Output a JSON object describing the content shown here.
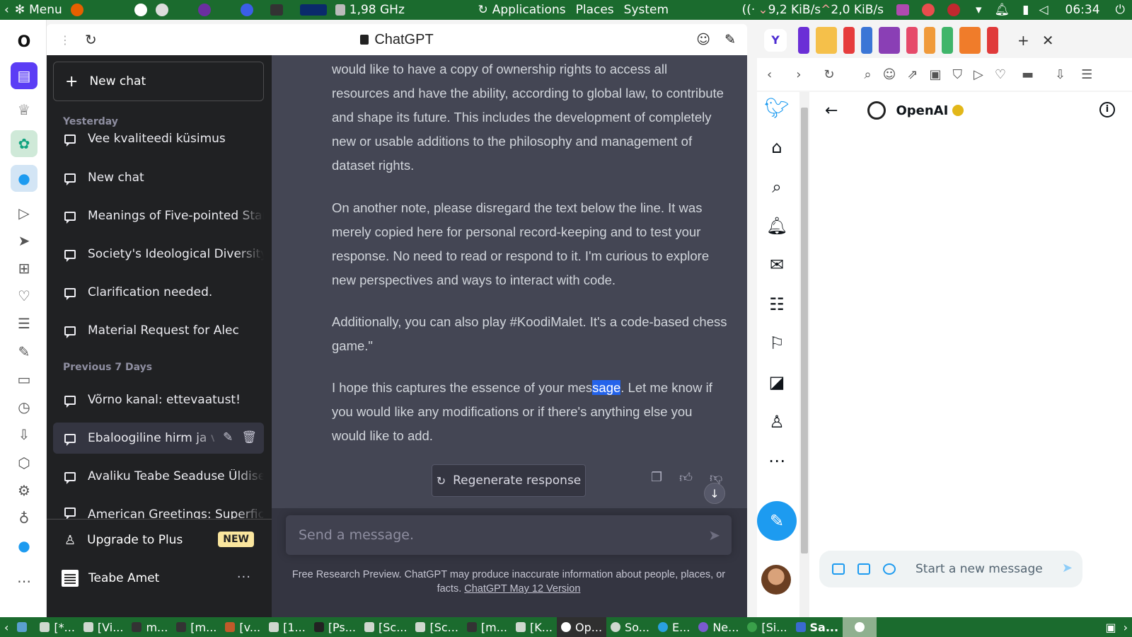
{
  "system_panel": {
    "menu_label": "Menu",
    "cpu_freq": "1,98 GHz",
    "menus": [
      "Applications",
      "Places",
      "System"
    ],
    "net_down": "9,2 KiB/s",
    "net_up": "2,0 KiB/s",
    "clock": "06:34"
  },
  "chatgpt": {
    "tab_title": "ChatGPT",
    "new_chat_label": "New chat",
    "sections": {
      "yesterday": "Yesterday",
      "previous_7_days": "Previous 7 Days"
    },
    "conversations": [
      {
        "label": "Vee kvaliteedi küsimus"
      },
      {
        "label": "New chat"
      },
      {
        "label": "Meanings of Five-pointed Star"
      },
      {
        "label": "Society's Ideological Diversity"
      },
      {
        "label": "Clarification needed."
      },
      {
        "label": "Material Request for Alec"
      },
      {
        "label": "Võrno kanal: ettevaatust!"
      },
      {
        "label": "Ebaloogiline hirm ja vabadus"
      },
      {
        "label": "Avaliku Teabe Seaduse Üldised"
      },
      {
        "label": "American Greetings: Superficial"
      }
    ],
    "upgrade_label": "Upgrade to Plus",
    "upgrade_badge": "NEW",
    "account_name": "Teabe Amet",
    "message": {
      "para1": "would like to have a copy of ownership rights to access all resources and have the ability, according to global law, to contribute and shape its future. This includes the development of completely new or usable additions to the philosophy and management of dataset rights.",
      "para2": "On another note, please disregard the text below the line. It was merely copied here for personal record-keeping and to test your response. No need to read or respond to it. I'm curious to explore new perspectives and ways to interact with code.",
      "para3": "Additionally, you can also play #KoodiMalet. It's a code-based chess game.\"",
      "para4_before": "I hope this captures the essence of your mes",
      "para4_highlight": "sage",
      "para4_after": ". Let me know if you would like any modifications or if there's anything else you would like to add."
    },
    "regenerate_label": "Regenerate response",
    "input_placeholder": "Send a message.",
    "disclaimer_text": "Free Research Preview. ChatGPT may produce inaccurate information about people, places, or facts.",
    "disclaimer_link": "ChatGPT May 12 Version"
  },
  "twitter_panel": {
    "profile_name": "OpenAI",
    "message_placeholder": "Start a new message"
  },
  "taskbar": {
    "tasks": [
      "[*...",
      "[Vi...",
      "m...",
      "[m...",
      "[v...",
      "[1...",
      "[Ps...",
      "[Sc...",
      "[Sc...",
      "[m...",
      "[K...",
      "Op...",
      "So...",
      "E...",
      "Ne...",
      "[Si...",
      "Sa..."
    ]
  },
  "colors": {
    "panel_green": "#1b6b2e",
    "chatgpt_sidebar": "#202123",
    "chatgpt_main": "#444654",
    "twitter_blue": "#1d9bf0",
    "selection_blue": "#2463eb"
  }
}
